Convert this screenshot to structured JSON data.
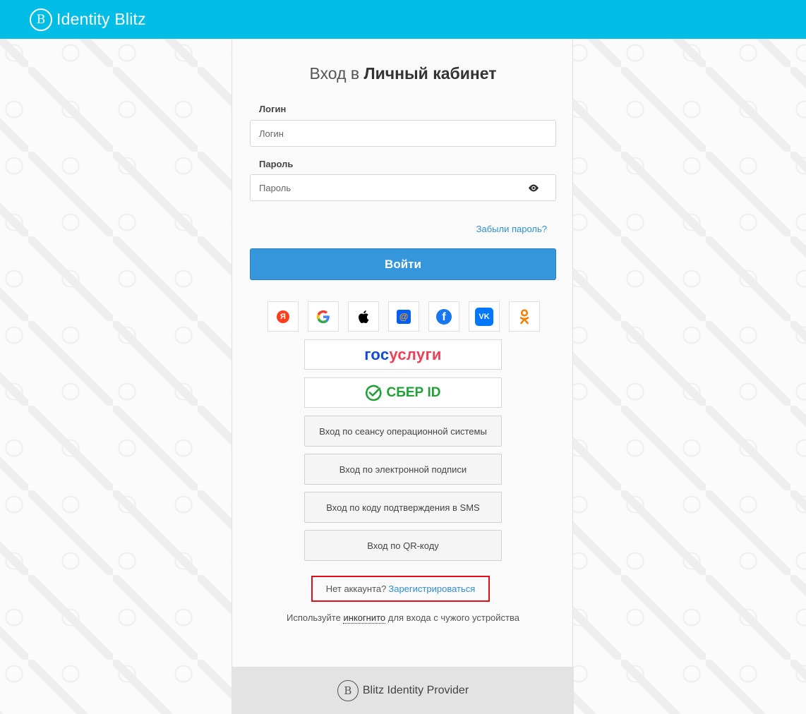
{
  "header": {
    "logo_glyph": "B",
    "brand": "Identity Blitz"
  },
  "form": {
    "title_prefix": "Вход в",
    "title_bold": "Личный кабинет",
    "login_label": "Логин",
    "login_placeholder": "Логин",
    "password_label": "Пароль",
    "password_placeholder": "Пароль",
    "forgot_link": "Забыли пароль?",
    "submit_label": "Войти"
  },
  "socials": [
    {
      "name": "yandex",
      "glyph": "Я",
      "color": "#fc3f1d"
    },
    {
      "name": "google",
      "glyph": "G",
      "color": "#4285f4"
    },
    {
      "name": "apple",
      "glyph": "",
      "color": "#000000"
    },
    {
      "name": "mailru",
      "glyph": "@",
      "color": "#005ff9"
    },
    {
      "name": "facebook",
      "glyph": "f",
      "color": "#1877f2"
    },
    {
      "name": "vk",
      "glyph": "VK",
      "color": "#0077ff"
    },
    {
      "name": "odnoklassniki",
      "glyph": "ok",
      "color": "#ee8208"
    }
  ],
  "gosuslugi": {
    "part1": "гос",
    "part2": "услуги"
  },
  "sber": {
    "label": "СБЕР ID"
  },
  "alt_logins": [
    "Вход по сеансу операционной системы",
    "Вход по электронной подписи",
    "Вход по коду подтверждения в SMS",
    "Вход по QR-коду"
  ],
  "register": {
    "prompt": "Нет аккаунта?",
    "link": "Зарегистрироваться"
  },
  "incognito": {
    "before": "Используйте",
    "link": "инкогнито",
    "after": "для входа с чужого устройства"
  },
  "footer": {
    "logo_glyph": "B",
    "text": "Blitz Identity Provider"
  },
  "colors": {
    "topbar": "#00bde6",
    "primary": "#3596dc",
    "link": "#2f8fd5",
    "highlight": "#e0101b"
  }
}
